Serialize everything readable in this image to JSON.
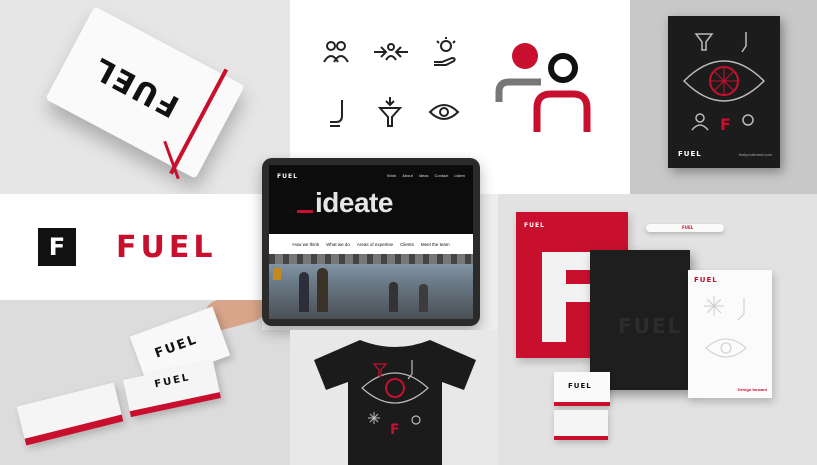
{
  "brand": {
    "name": "FUEL",
    "logo_letter": "F",
    "colors": {
      "red": "#c8102e",
      "black": "#111111",
      "white": "#ffffff",
      "gray": "#b5b5b5"
    }
  },
  "notebook": {
    "cover_text": "FUEL"
  },
  "icons": [
    "people-icon",
    "converge-arrows-icon",
    "idea-hand-icon",
    "tool-icon",
    "funnel-icon",
    "eye-icon"
  ],
  "poster": {
    "logo": "FUEL",
    "footer": "fuelyourbrand.com"
  },
  "website": {
    "logo": "FUEL",
    "nav": [
      "Work",
      "About",
      "Ideas",
      "Contact",
      "Listen"
    ],
    "hero_word": "ideate",
    "menu": [
      "How we think",
      "What we do",
      "Areas of expertise",
      "Clients",
      "Meet the team"
    ]
  },
  "business_cards": {
    "top_card": "FUEL",
    "bottom_card": "FUEL"
  },
  "stationery": {
    "folder_logo": "FUEL",
    "pen_logo": "FUEL",
    "letterhead_logo": "FUEL",
    "letterhead_footer": "Design forward",
    "small_card": "FUEL"
  },
  "tshirt": {
    "letter": "F"
  }
}
